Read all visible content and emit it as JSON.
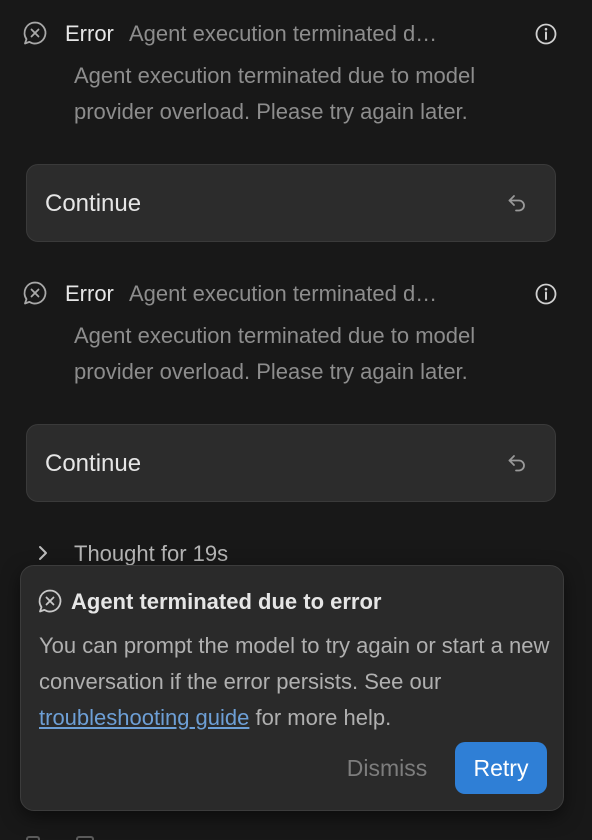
{
  "errors": [
    {
      "label": "Error",
      "summary": "Agent execution terminated d…",
      "detail": "Agent execution terminated due to model provider overload. Please try again later.",
      "continue_label": "Continue"
    },
    {
      "label": "Error",
      "summary": "Agent execution terminated d…",
      "detail": "Agent execution terminated due to model provider overload. Please try again later.",
      "continue_label": "Continue"
    }
  ],
  "thought": {
    "label": "Thought for 19s"
  },
  "toast": {
    "title": "Agent terminated due to error",
    "body_before_link": "You can prompt the model to try again or start a new conversation if the error persists. See our ",
    "link_text": "troubleshooting guide",
    "body_after_link": " for more help.",
    "dismiss_label": "Dismiss",
    "retry_label": "Retry"
  },
  "icons": {
    "error": "error-bubble-icon",
    "info": "info-icon",
    "undo": "undo-arrow-icon",
    "chevron": "chevron-right-icon"
  },
  "colors": {
    "background": "#181818",
    "accent": "#2f7fd6",
    "link": "#6d9fd6"
  }
}
